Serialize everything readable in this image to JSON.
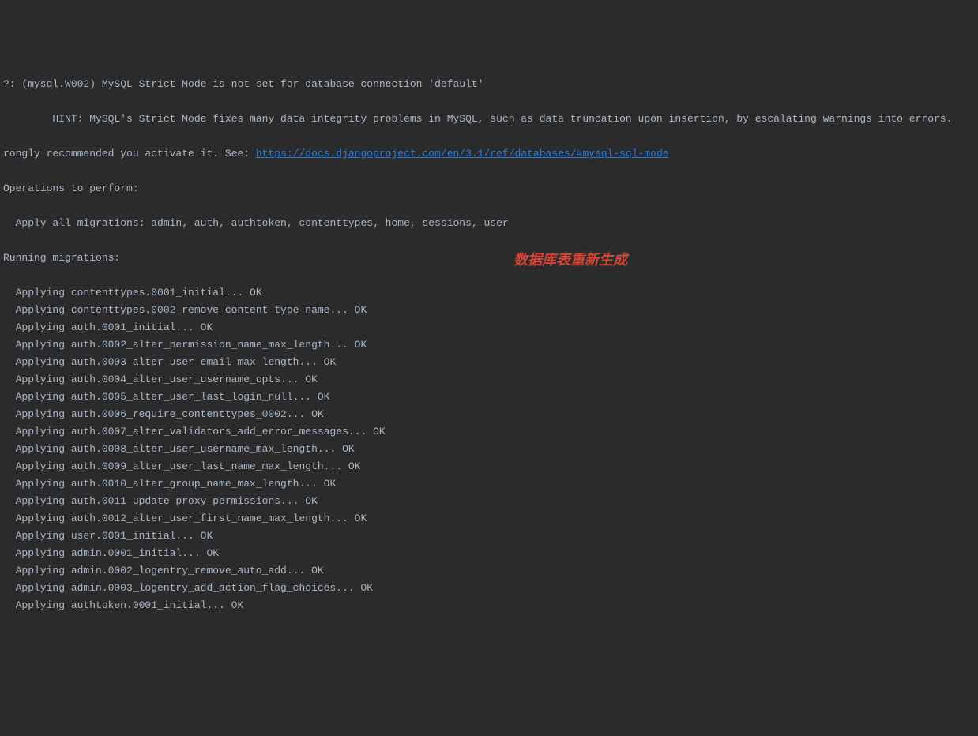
{
  "warning_prefix": "?: (mysql.W002) MySQL Strict Mode is not set for database connection 'default'",
  "hint_line_pre": "        HINT: MySQL's Strict Mode fixes many data integrity problems in MySQL, such as data truncation upon insertion, by escalating warnings into errors.",
  "hint_line2_pre": "rongly recommended you activate it. See: ",
  "doc_link": "https://docs.djangoproject.com/en/3.1/ref/databases/#mysql-sql-mode",
  "operations_header": "Operations to perform:",
  "apply_all": "  Apply all migrations: admin, auth, authtoken, contenttypes, home, sessions, user",
  "running_header": "Running migrations:",
  "migrations": [
    "  Applying contenttypes.0001_initial... OK",
    "  Applying contenttypes.0002_remove_content_type_name... OK",
    "  Applying auth.0001_initial... OK",
    "  Applying auth.0002_alter_permission_name_max_length... OK",
    "  Applying auth.0003_alter_user_email_max_length... OK",
    "  Applying auth.0004_alter_user_username_opts... OK",
    "  Applying auth.0005_alter_user_last_login_null... OK",
    "  Applying auth.0006_require_contenttypes_0002... OK",
    "  Applying auth.0007_alter_validators_add_error_messages... OK",
    "  Applying auth.0008_alter_user_username_max_length... OK",
    "  Applying auth.0009_alter_user_last_name_max_length... OK",
    "  Applying auth.0010_alter_group_name_max_length... OK",
    "  Applying auth.0011_update_proxy_permissions... OK",
    "  Applying auth.0012_alter_user_first_name_max_length... OK",
    "  Applying user.0001_initial... OK",
    "  Applying admin.0001_initial... OK",
    "  Applying admin.0002_logentry_remove_auto_add... OK",
    "  Applying admin.0003_logentry_add_action_flag_choices... OK",
    "  Applying authtoken.0001_initial... OK"
  ],
  "annotation_text": "数据库表重新生成"
}
